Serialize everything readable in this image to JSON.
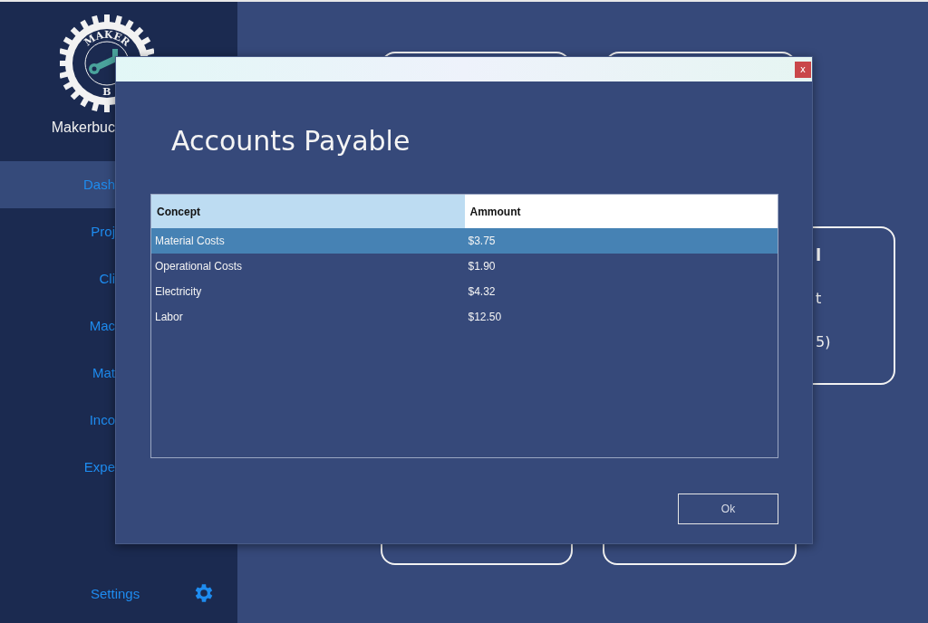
{
  "sidebar": {
    "logo": {
      "top_text": "MAKER",
      "bottom_text": "B"
    },
    "brand": "Makerbuc",
    "items": [
      {
        "label": "Dash",
        "selected": true
      },
      {
        "label": "Proj",
        "selected": false
      },
      {
        "label": "Cli",
        "selected": false
      },
      {
        "label": "Mac",
        "selected": false
      },
      {
        "label": "Mat",
        "selected": false
      },
      {
        "label": "Inco",
        "selected": false
      },
      {
        "label": "Expe",
        "selected": false
      }
    ],
    "settings": {
      "label": "Settings"
    }
  },
  "background_card": {
    "lines": [
      "l",
      "t",
      "5)"
    ]
  },
  "dialog": {
    "close_label": "x",
    "heading": "Accounts Payable",
    "table": {
      "columns": [
        "Concept",
        "Ammount"
      ],
      "rows": [
        {
          "cells": [
            "Material Costs",
            "$3.75"
          ],
          "selected": true
        },
        {
          "cells": [
            "Operational Costs",
            "$1.90"
          ],
          "selected": false
        },
        {
          "cells": [
            "Electricity",
            "$4.32"
          ],
          "selected": false
        },
        {
          "cells": [
            "Labor",
            "$12.50"
          ],
          "selected": false
        }
      ]
    },
    "buttons": [
      "Ok"
    ]
  }
}
